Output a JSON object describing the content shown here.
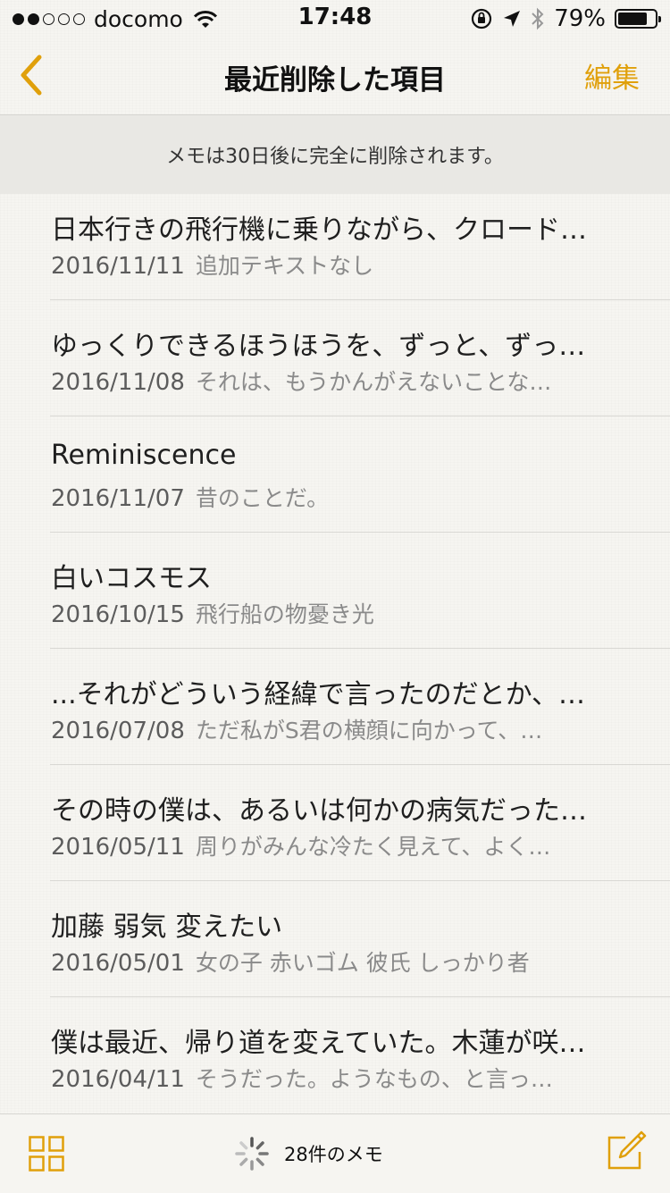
{
  "status_bar": {
    "carrier": "docomo",
    "time": "17:48",
    "battery_percent": "79%",
    "battery_level": 0.79,
    "signal_bars_filled": 2,
    "signal_bars_total": 5
  },
  "nav": {
    "title": "最近削除した項目",
    "edit_label": "編集",
    "accent_color": "#e0a00b"
  },
  "banner": {
    "text": "メモは30日後に完全に削除されます。"
  },
  "notes": [
    {
      "title": "日本行きの飛行機に乗りながら、クロード…",
      "date": "2016/11/11",
      "preview": "追加テキストなし"
    },
    {
      "title": "ゆっくりできるほうほうを、ずっと、ずっ…",
      "date": "2016/11/08",
      "preview": "それは、もうかんがえないことな…"
    },
    {
      "title": "Reminiscence",
      "date": "2016/11/07",
      "preview": "昔のことだ。"
    },
    {
      "title": "白いコスモス",
      "date": "2016/10/15",
      "preview": "飛行船の物憂き光"
    },
    {
      "title": "...それがどういう経緯で言ったのだとか、…",
      "date": "2016/07/08",
      "preview": "ただ私がS君の横顔に向かって、…"
    },
    {
      "title": "その時の僕は、あるいは何かの病気だった…",
      "date": "2016/05/11",
      "preview": "周りがみんな冷たく見えて、よく…"
    },
    {
      "title": "加藤 弱気 変えたい",
      "date": "2016/05/01",
      "preview": "女の子 赤いゴム 彼氏 しっかり者"
    },
    {
      "title": "僕は最近、帰り道を変えていた。木蓮が咲…",
      "date": "2016/04/11",
      "preview": "そうだった。ようなもの、と言っ…"
    }
  ],
  "toolbar": {
    "count_label": "28件のメモ"
  },
  "icons": {
    "back": "chevron-left-icon",
    "grid": "grid-icon",
    "spinner": "spinner-icon",
    "compose": "compose-icon"
  }
}
